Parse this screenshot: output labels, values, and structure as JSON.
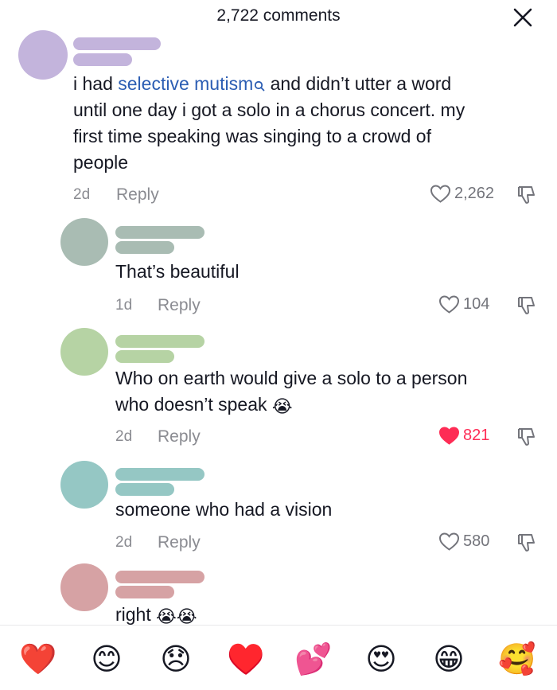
{
  "header": {
    "title": "2,722 comments",
    "close_icon": "close-icon"
  },
  "comments": [
    {
      "avatar_color": "#c3b4dc",
      "name_bar_color": "#c3b4dc",
      "text_before": "i had ",
      "text_link": "selective mutism",
      "text_after_line1": " and didn’t utter a word",
      "text_line2": "until one day i got a solo in a chorus concert. my",
      "text_line3": "first time speaking was singing to a crowd of",
      "text_line4": "people",
      "time": "2d",
      "reply": "Reply",
      "likes": "2,262",
      "liked": false
    },
    {
      "avatar_color": "#a9bcb3",
      "name_bar_color": "#a9bcb3",
      "text": "That’s beautiful",
      "time": "1d",
      "reply": "Reply",
      "likes": "104",
      "liked": false
    },
    {
      "avatar_color": "#b6d3a4",
      "name_bar_color": "#b6d3a4",
      "text_line1": "Who on earth would give a solo to a person",
      "text_line2": "who doesn’t speak",
      "text_emoji": "😭",
      "time": "2d",
      "reply": "Reply",
      "likes": "821",
      "liked": true
    },
    {
      "avatar_color": "#95c7c4",
      "name_bar_color": "#95c7c4",
      "text": "someone who had a vision",
      "time": "2d",
      "reply": "Reply",
      "likes": "580",
      "liked": false
    },
    {
      "avatar_color": "#d6a2a4",
      "name_bar_color": "#d6a2a4",
      "text": "right",
      "text_emoji": "😭😭"
    }
  ],
  "emoji_bar": [
    "❤️",
    "😊",
    "😞",
    "♥️",
    "💕",
    "😍",
    "😁",
    "🥰"
  ],
  "colors": {
    "link": "#2b5db3",
    "liked": "#fe2c55",
    "muted": "#8a8b91"
  }
}
